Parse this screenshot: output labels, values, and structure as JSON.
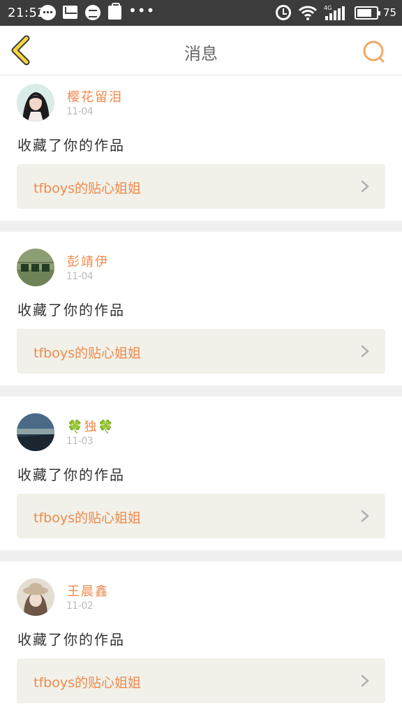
{
  "status_bar": {
    "time": "21:52",
    "network": "4G",
    "battery_level": "75",
    "icons": [
      "chat-bubble-icon",
      "mail-icon",
      "message-icon",
      "shopping-bag-icon",
      "more-dots-icon",
      "alarm-icon",
      "wifi-icon",
      "signal-icon",
      "battery-icon"
    ]
  },
  "nav": {
    "title": "消息",
    "back_icon": "chevron-left-icon",
    "search_icon": "search-icon"
  },
  "colors": {
    "accent": "#f08a4b",
    "back_icon": "#f5d53b",
    "card_link_bg": "#f1f1ea",
    "separator": "#f0f0f0"
  },
  "notifications": [
    {
      "user": "樱花留泪",
      "date": "11-04",
      "action": "收藏了你的作品",
      "work": "tfboys的贴心姐姐",
      "avatar": "avatar-girl-portrait"
    },
    {
      "user": "彭靖伊",
      "date": "11-04",
      "action": "收藏了你的作品",
      "work": "tfboys的贴心姐姐",
      "avatar": "avatar-clover-tags"
    },
    {
      "user": "🍀独🍀",
      "date": "11-03",
      "action": "收藏了你的作品",
      "work": "tfboys的贴心姐姐",
      "avatar": "avatar-seaside-dusk"
    },
    {
      "user": "王晨鑫",
      "date": "11-02",
      "action": "收藏了你的作品",
      "work": "tfboys的贴心姐姐",
      "avatar": "avatar-girl-hat"
    }
  ]
}
